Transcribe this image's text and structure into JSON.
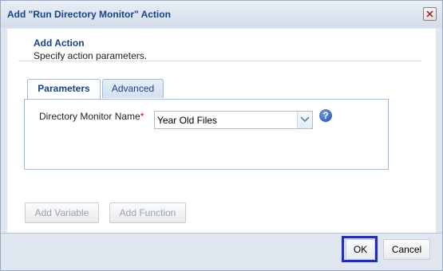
{
  "window": {
    "title": "Add \"Run Directory Monitor\" Action",
    "close_icon": "close-icon"
  },
  "header": {
    "title": "Add Action",
    "description": "Specify action parameters."
  },
  "tabs": [
    {
      "label": "Parameters",
      "active": true
    },
    {
      "label": "Advanced",
      "active": false
    }
  ],
  "form": {
    "directory_monitor_name": {
      "label": "Directory Monitor Name",
      "required_marker": "*",
      "value": "Year Old Files"
    },
    "help_icon": "help-icon"
  },
  "actions": {
    "add_variable": "Add Variable",
    "add_function": "Add Function"
  },
  "footer": {
    "ok": "OK",
    "cancel": "Cancel"
  },
  "colors": {
    "accent": "#15428b",
    "focus_border": "#1e2bd1",
    "required": "#cc0000"
  }
}
